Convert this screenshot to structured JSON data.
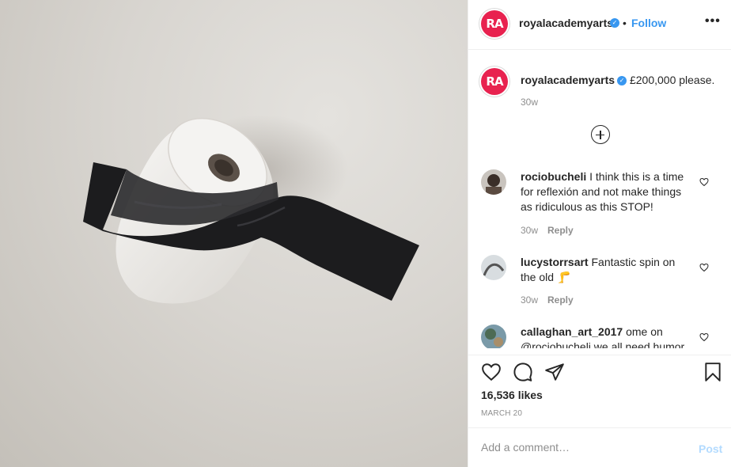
{
  "post": {
    "username": "royalacademyarts",
    "avatar_initials": "RA",
    "follow_label": "Follow",
    "separator": "•",
    "more_label": "•••",
    "caption": "£200,000 please.",
    "age": "30w",
    "likes": "16,536 likes",
    "date": "MARCH 20"
  },
  "comments": [
    {
      "username": "rociobucheli",
      "text": "I think this is a time for reflexión and not make things as ridiculous as this STOP!",
      "age": "30w",
      "reply": "Reply"
    },
    {
      "username": "lucystorrsart",
      "text": "Fantastic spin on the old",
      "emoji": "🦵",
      "age": "30w",
      "reply": "Reply"
    },
    {
      "username": "callaghan_art_2017",
      "text": "ome on @rociobucheli we all need humor"
    }
  ],
  "composer": {
    "placeholder": "Add a comment…",
    "post_label": "Post"
  },
  "colors": {
    "accent": "#3897f0",
    "brand": "#e8224f",
    "muted": "#8e8e8e"
  }
}
